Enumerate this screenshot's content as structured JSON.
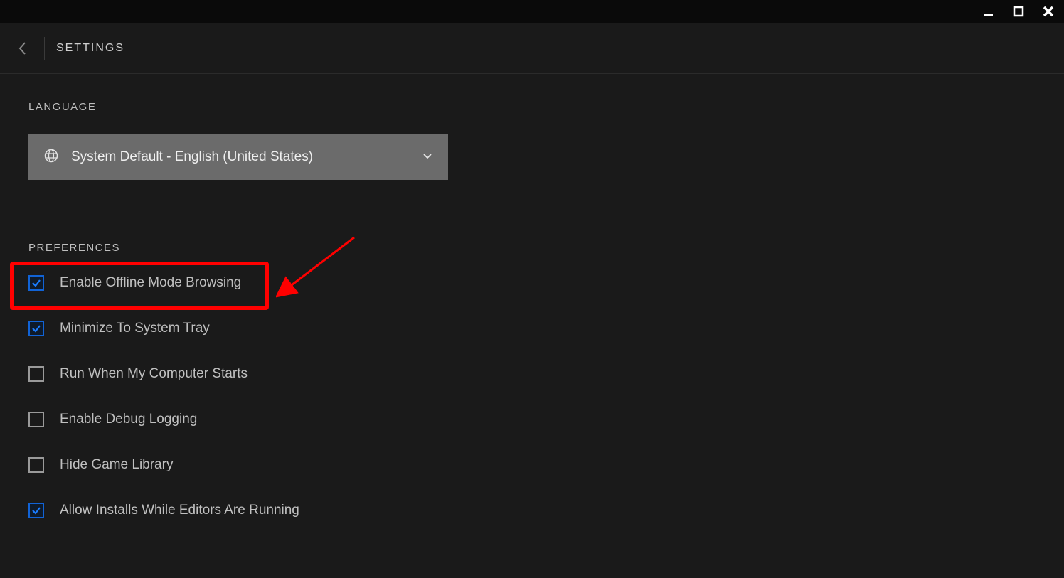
{
  "header": {
    "title": "SETTINGS"
  },
  "language": {
    "section_title": "LANGUAGE",
    "selected": "System Default - English (United States)"
  },
  "preferences": {
    "section_title": "PREFERENCES",
    "items": [
      {
        "label": "Enable Offline Mode Browsing",
        "checked": true,
        "highlighted": true
      },
      {
        "label": "Minimize To System Tray",
        "checked": true,
        "highlighted": false
      },
      {
        "label": "Run When My Computer Starts",
        "checked": false,
        "highlighted": false
      },
      {
        "label": "Enable Debug Logging",
        "checked": false,
        "highlighted": false
      },
      {
        "label": "Hide Game Library",
        "checked": false,
        "highlighted": false
      },
      {
        "label": "Allow Installs While Editors Are Running",
        "checked": true,
        "highlighted": false
      }
    ]
  }
}
